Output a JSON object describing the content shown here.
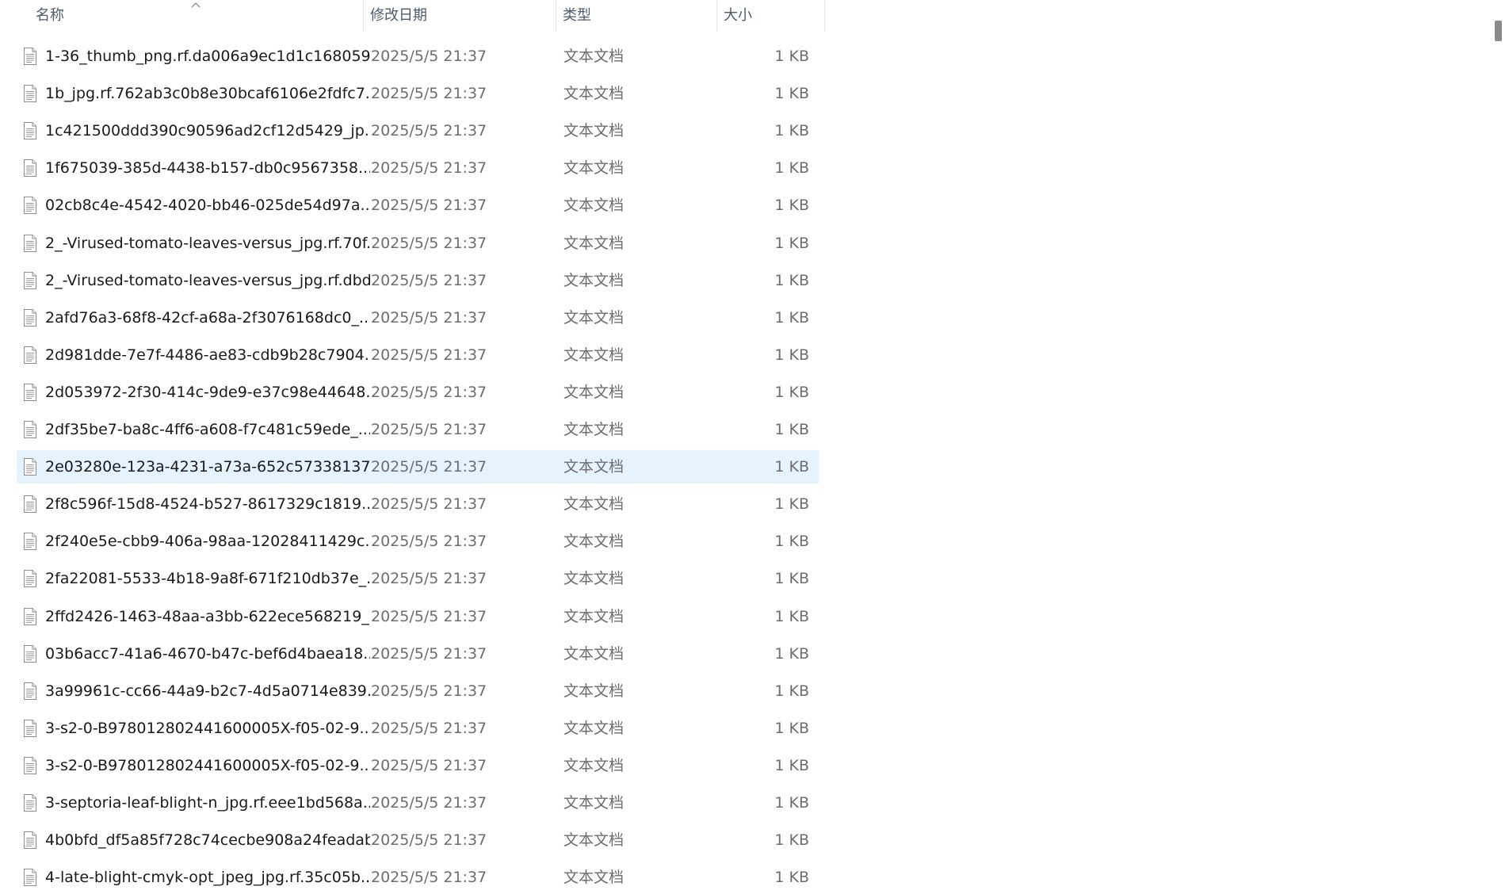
{
  "columns": {
    "name": "名称",
    "date": "修改日期",
    "type": "类型",
    "size": "大小"
  },
  "sort": {
    "column": "name",
    "direction": "ascending",
    "icon": "chevron-up-icon"
  },
  "selected_index": 11,
  "files": [
    {
      "name": "1-36_thumb_png.rf.da006a9ec1d1c168059...",
      "date": "2025/5/5 21:37",
      "type": "文本文档",
      "size": "1 KB"
    },
    {
      "name": "1b_jpg.rf.762ab3c0b8e30bcaf6106e2fdfc7...",
      "date": "2025/5/5 21:37",
      "type": "文本文档",
      "size": "1 KB"
    },
    {
      "name": "1c421500ddd390c90596ad2cf12d5429_jp...",
      "date": "2025/5/5 21:37",
      "type": "文本文档",
      "size": "1 KB"
    },
    {
      "name": "1f675039-385d-4438-b157-db0c9567358...",
      "date": "2025/5/5 21:37",
      "type": "文本文档",
      "size": "1 KB"
    },
    {
      "name": "02cb8c4e-4542-4020-bb46-025de54d97a...",
      "date": "2025/5/5 21:37",
      "type": "文本文档",
      "size": "1 KB"
    },
    {
      "name": "2_-Virused-tomato-leaves-versus_jpg.rf.70f...",
      "date": "2025/5/5 21:37",
      "type": "文本文档",
      "size": "1 KB"
    },
    {
      "name": "2_-Virused-tomato-leaves-versus_jpg.rf.dbd...",
      "date": "2025/5/5 21:37",
      "type": "文本文档",
      "size": "1 KB"
    },
    {
      "name": "2afd76a3-68f8-42cf-a68a-2f3076168dc0_...",
      "date": "2025/5/5 21:37",
      "type": "文本文档",
      "size": "1 KB"
    },
    {
      "name": "2d981dde-7e7f-4486-ae83-cdb9b28c7904...",
      "date": "2025/5/5 21:37",
      "type": "文本文档",
      "size": "1 KB"
    },
    {
      "name": "2d053972-2f30-414c-9de9-e37c98e44648...",
      "date": "2025/5/5 21:37",
      "type": "文本文档",
      "size": "1 KB"
    },
    {
      "name": "2df35be7-ba8c-4ff6-a608-f7c481c59ede_...",
      "date": "2025/5/5 21:37",
      "type": "文本文档",
      "size": "1 KB"
    },
    {
      "name": "2e03280e-123a-4231-a73a-652c57338137...",
      "date": "2025/5/5 21:37",
      "type": "文本文档",
      "size": "1 KB"
    },
    {
      "name": "2f8c596f-15d8-4524-b527-8617329c1819...",
      "date": "2025/5/5 21:37",
      "type": "文本文档",
      "size": "1 KB"
    },
    {
      "name": "2f240e5e-cbb9-406a-98aa-12028411429c...",
      "date": "2025/5/5 21:37",
      "type": "文本文档",
      "size": "1 KB"
    },
    {
      "name": "2fa22081-5533-4b18-9a8f-671f210db37e_...",
      "date": "2025/5/5 21:37",
      "type": "文本文档",
      "size": "1 KB"
    },
    {
      "name": "2ffd2426-1463-48aa-a3bb-622ece568219_...",
      "date": "2025/5/5 21:37",
      "type": "文本文档",
      "size": "1 KB"
    },
    {
      "name": "03b6acc7-41a6-4670-b47c-bef6d4baea18...",
      "date": "2025/5/5 21:37",
      "type": "文本文档",
      "size": "1 KB"
    },
    {
      "name": "3a99961c-cc66-44a9-b2c7-4d5a0714e839...",
      "date": "2025/5/5 21:37",
      "type": "文本文档",
      "size": "1 KB"
    },
    {
      "name": "3-s2-0-B978012802441600005X-f05-02-9...",
      "date": "2025/5/5 21:37",
      "type": "文本文档",
      "size": "1 KB"
    },
    {
      "name": "3-s2-0-B978012802441600005X-f05-02-9...",
      "date": "2025/5/5 21:37",
      "type": "文本文档",
      "size": "1 KB"
    },
    {
      "name": "3-septoria-leaf-blight-n_jpg.rf.eee1bd568a...",
      "date": "2025/5/5 21:37",
      "type": "文本文档",
      "size": "1 KB"
    },
    {
      "name": "4b0bfd_df5a85f728c74cecbe908a24feadab...",
      "date": "2025/5/5 21:37",
      "type": "文本文档",
      "size": "1 KB"
    },
    {
      "name": "4-late-blight-cmyk-opt_jpeg_jpg.rf.35c05b...",
      "date": "2025/5/5 21:37",
      "type": "文本文档",
      "size": "1 KB"
    }
  ],
  "icons": {
    "file": "text-document-icon",
    "scroll": "scrollbar-thumb"
  },
  "colors": {
    "selected_row": "#e5f3ff",
    "header_text": "#4d5b6e",
    "name_text": "#1a1a1a",
    "meta_text": "#6d6d6d"
  }
}
